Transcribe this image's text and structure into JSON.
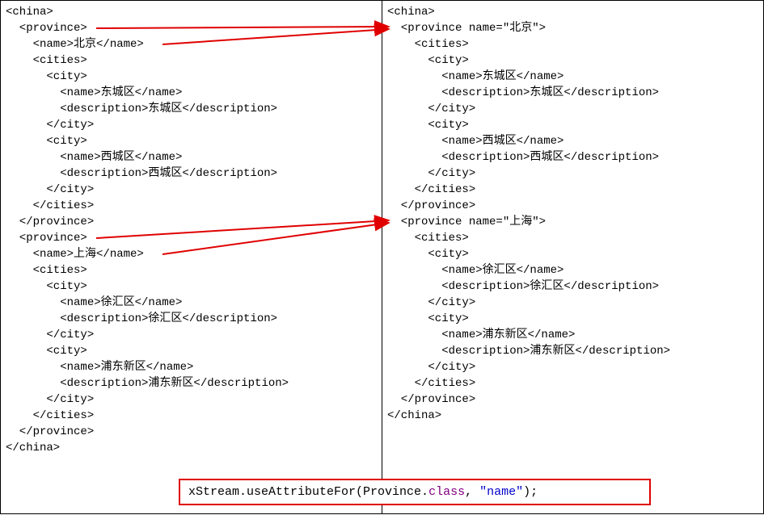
{
  "left_pane": {
    "root_open": "<china>",
    "prov1_open": "  <province>",
    "prov1_name": "    <name>北京</name>",
    "prov1_cities_open": "    <cities>",
    "prov1_city1_open": "      <city>",
    "prov1_city1_name": "        <name>东城区</name>",
    "prov1_city1_desc": "        <description>东城区</description>",
    "prov1_city1_close": "      </city>",
    "prov1_city2_open": "      <city>",
    "prov1_city2_name": "        <name>西城区</name>",
    "prov1_city2_desc": "        <description>西城区</description>",
    "prov1_city2_close": "      </city>",
    "prov1_cities_close": "    </cities>",
    "prov1_close": "  </province>",
    "prov2_open": "  <province>",
    "prov2_name": "    <name>上海</name>",
    "prov2_cities_open": "    <cities>",
    "prov2_city1_open": "      <city>",
    "prov2_city1_name": "        <name>徐汇区</name>",
    "prov2_city1_desc": "        <description>徐汇区</description>",
    "prov2_city1_close": "      </city>",
    "prov2_city2_open": "      <city>",
    "prov2_city2_name": "        <name>浦东新区</name>",
    "prov2_city2_desc": "        <description>浦东新区</description>",
    "prov2_city2_close": "      </city>",
    "prov2_cities_close": "    </cities>",
    "prov2_close": "  </province>",
    "root_close": "</china>"
  },
  "right_pane": {
    "root_open": "<china>",
    "prov1_open": "  <province name=\"北京\">",
    "prov1_cities_open": "    <cities>",
    "prov1_city1_open": "      <city>",
    "prov1_city1_name": "        <name>东城区</name>",
    "prov1_city1_desc": "        <description>东城区</description>",
    "prov1_city1_close": "      </city>",
    "prov1_city2_open": "      <city>",
    "prov1_city2_name": "        <name>西城区</name>",
    "prov1_city2_desc": "        <description>西城区</description>",
    "prov1_city2_close": "      </city>",
    "prov1_cities_close": "    </cities>",
    "prov1_close": "  </province>",
    "prov2_open": "  <province name=\"上海\">",
    "prov2_cities_open": "    <cities>",
    "prov2_city1_open": "      <city>",
    "prov2_city1_name": "        <name>徐汇区</name>",
    "prov2_city1_desc": "        <description>徐汇区</description>",
    "prov2_city1_close": "      </city>",
    "prov2_city2_open": "      <city>",
    "prov2_city2_name": "        <name>浦东新区</name>",
    "prov2_city2_desc": "        <description>浦东新区</description>",
    "prov2_city2_close": "      </city>",
    "prov2_cities_close": "    </cities>",
    "prov2_close": "  </province>",
    "root_close": "</china>"
  },
  "code": {
    "pre": "xStream.useAttributeFor(Province.",
    "cls": "class",
    "mid": ", ",
    "str": "\"name\"",
    "post": ");"
  }
}
